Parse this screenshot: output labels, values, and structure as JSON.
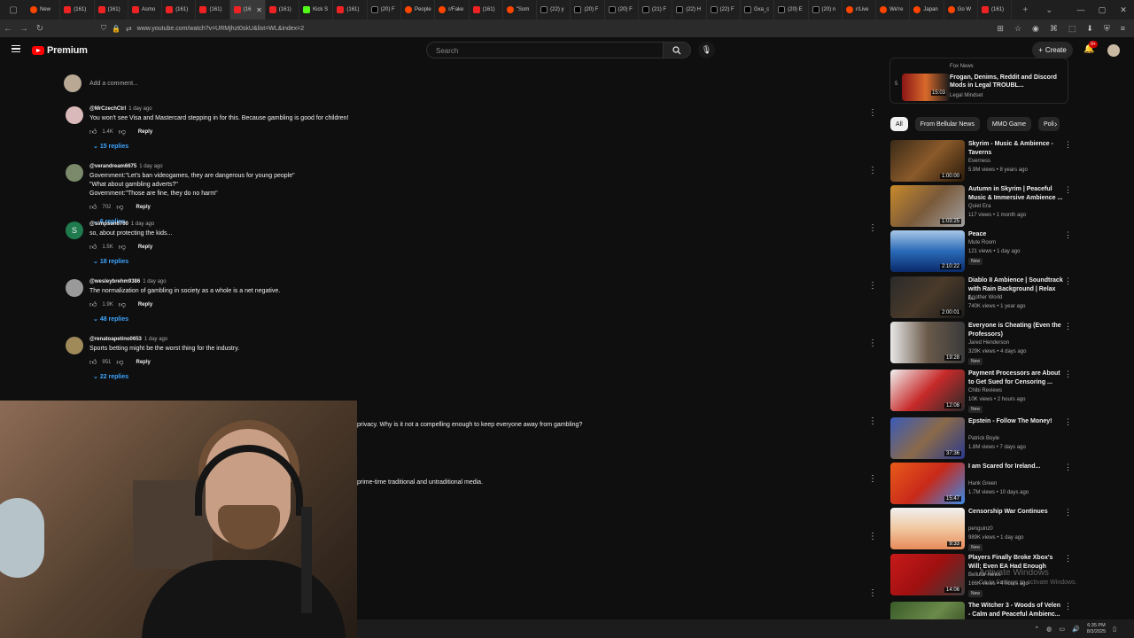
{
  "browser": {
    "tabs": [
      {
        "label": "New",
        "icon": "reddit"
      },
      {
        "label": "(161)",
        "icon": "yt"
      },
      {
        "label": "(161)",
        "icon": "yt"
      },
      {
        "label": "Asmo",
        "icon": "yt"
      },
      {
        "label": "(161)",
        "icon": "yt"
      },
      {
        "label": "(161)",
        "icon": "yt"
      },
      {
        "label": "(16",
        "icon": "yt",
        "active": true
      },
      {
        "label": "(161)",
        "icon": "yt"
      },
      {
        "label": "Kick S",
        "icon": "kick"
      },
      {
        "label": "(161)",
        "icon": "yt"
      },
      {
        "label": "(20) F",
        "icon": "x"
      },
      {
        "label": "People",
        "icon": "reddit"
      },
      {
        "label": "r/Fake",
        "icon": "reddit"
      },
      {
        "label": "(161)",
        "icon": "yt"
      },
      {
        "label": "\"Som",
        "icon": "reddit"
      },
      {
        "label": "(22) y",
        "icon": "x"
      },
      {
        "label": "(20) F",
        "icon": "x"
      },
      {
        "label": "(20) F",
        "icon": "x"
      },
      {
        "label": "(21) F",
        "icon": "x"
      },
      {
        "label": "(22) H",
        "icon": "x"
      },
      {
        "label": "(22) F",
        "icon": "x"
      },
      {
        "label": "Gxa_c",
        "icon": "x"
      },
      {
        "label": "(20) E",
        "icon": "x"
      },
      {
        "label": "(20) n",
        "icon": "x"
      },
      {
        "label": "r/Live",
        "icon": "reddit"
      },
      {
        "label": "We're",
        "icon": "reddit"
      },
      {
        "label": "Japan",
        "icon": "reddit"
      },
      {
        "label": "Go W",
        "icon": "reddit"
      },
      {
        "label": "(161)",
        "icon": "yt"
      }
    ],
    "new_tab_label": "+",
    "url": "www.youtube.com/watch?v=URMjhzt0skU&list=WL&index=2"
  },
  "header": {
    "brand": "Premium",
    "search_placeholder": "Search",
    "create_label": "Create",
    "notification_count": "9+"
  },
  "add_comment_placeholder": "Add a comment...",
  "comments": [
    {
      "user": "@MrCzechCtrl",
      "time": "1 day ago",
      "text": "You won't see Visa and Mastercard stepping in for this. Because gambling is good for children!",
      "likes": "1.4K",
      "replies": "15 replies",
      "avatar_color": "#d9b9b9"
    },
    {
      "user": "@verandream6675",
      "time": "1 day ago",
      "text": "Government:\"Let's ban videogames, they are dangerous for young people\"\n\"What about gambling adverts?\"\nGovernment:\"Those are fine, they do no harm\"",
      "likes": "702",
      "replies": "6 replies",
      "avatar_color": "#7a8a6a"
    },
    {
      "user": "@simpson6700",
      "time": "1 day ago",
      "text": "so, about protecting the kids...",
      "likes": "1.5K",
      "replies": "18 replies",
      "avatar_color": "#1f7a4e",
      "initial": "S"
    },
    {
      "user": "@wesleybrehm9386",
      "time": "1 day ago",
      "text": "The normalization of gambling in society as a whole is a net negative.",
      "likes": "1.9K",
      "replies": "48 replies",
      "avatar_color": "#9a9a9a"
    },
    {
      "user": "@renatoapetino0653",
      "time": "1 day ago",
      "text": "Sports betting might be the worst thing for the industry.",
      "likes": "951",
      "replies": "22 replies",
      "avatar_color": "#a08a5a"
    }
  ],
  "hidden_comment_tails": [
    "privacy. Why is it not a compelling enough to keep everyone away from gambling?",
    "prime-time traditional and untraditional media."
  ],
  "reply_label": "Reply",
  "sidebar": {
    "top_card": {
      "index": "5",
      "channel_top": "Fox News",
      "title": "Frogan, Denims, Reddit and Discord Mods in Legal TROUBL...",
      "channel": "Legal Mindset",
      "duration": "15:03"
    },
    "chips": [
      "All",
      "From Bellular News",
      "MMO Game",
      "Poli"
    ],
    "recommendations": [
      {
        "title": "Skyrim - Music & Ambience - Taverns",
        "channel": "Everness",
        "meta": "5.9M views • 8 years ago",
        "duration": "1:00:00",
        "thumb": "linear-gradient(135deg,#3a2a18,#8a5a2a,#2a1a0a)"
      },
      {
        "title": "Autumn in Skyrim | Peaceful Music & Immersive Ambience ...",
        "channel": "Quiet Era",
        "meta": "117 views • 1 month ago",
        "duration": "1:03:25",
        "thumb": "linear-gradient(135deg,#c88a2a,#7a5a3a,#a0a0a0)"
      },
      {
        "title": "Peace",
        "channel": "Mute Room",
        "meta": "121 views • 1 day ago",
        "duration": "2:10:22",
        "new": "New",
        "thumb": "linear-gradient(180deg,#a8c8e8,#2a6ab8,#0a2a6a)"
      },
      {
        "title": "Diablo II Ambience | Soundtrack with Rain Background | Relax I...",
        "channel": "Another World",
        "meta": "740K views • 1 year ago",
        "duration": "2:00:01",
        "thumb": "linear-gradient(135deg,#2a2a2a,#4a3a2a,#1a1a1a)"
      },
      {
        "title": "Everyone is Cheating (Even the Professors)",
        "channel": "Jared Henderson",
        "meta": "329K views • 4 days ago",
        "duration": "19:28",
        "new": "New",
        "thumb": "linear-gradient(90deg,#e8e8e8,#6a5a4a,#3a3a3a)"
      },
      {
        "title": "Payment Processors are About to Get Sued for Censoring ...",
        "channel": "Chibi Reviews",
        "meta": "10K views • 2 hours ago",
        "duration": "12:08",
        "new": "New",
        "thumb": "linear-gradient(135deg,#f0f0f0,#c82a2a,#2a2a2a)"
      },
      {
        "title": "Epstein - Follow The Money!",
        "channel": "Patrick Boyle",
        "meta": "1.8M views • 7 days ago",
        "duration": "37:36",
        "thumb": "linear-gradient(135deg,#3a5ab8,#8a6a4a,#2a3a8a)"
      },
      {
        "title": "I am Scared for Ireland...",
        "channel": "Hank Green",
        "meta": "1.7M views • 10 days ago",
        "duration": "15:47",
        "thumb": "linear-gradient(135deg,#e85a1a,#c82a1a,#3a8ae8)"
      },
      {
        "title": "Censorship War Continues",
        "channel": "penguinz0",
        "meta": "989K views • 1 day ago",
        "duration": "9:33",
        "new": "New",
        "thumb": "linear-gradient(180deg,#f0f0f0,#f0c8a0,#e88a5a)"
      },
      {
        "title": "Players Finally Broke Xbox's Will; Even EA Had Enough",
        "channel": "Bellular News",
        "meta": "166K views • 4 hours ago",
        "duration": "14:06",
        "new": "New",
        "thumb": "linear-gradient(135deg,#c81a1a,#a01010,#3a3a3a)"
      },
      {
        "title": "The Witcher 3 - Woods of Velen - Calm and Peaceful Ambienc...",
        "channel": "",
        "meta": "",
        "duration": "",
        "thumb": "linear-gradient(135deg,#3a5a2a,#6a8a4a,#2a3a1a)"
      }
    ]
  },
  "watermark": {
    "line1": "Activate Windows",
    "line2": "Go to Settings to activate Windows."
  },
  "taskbar": {
    "time": "6:35 PM",
    "date": "8/3/2025"
  }
}
